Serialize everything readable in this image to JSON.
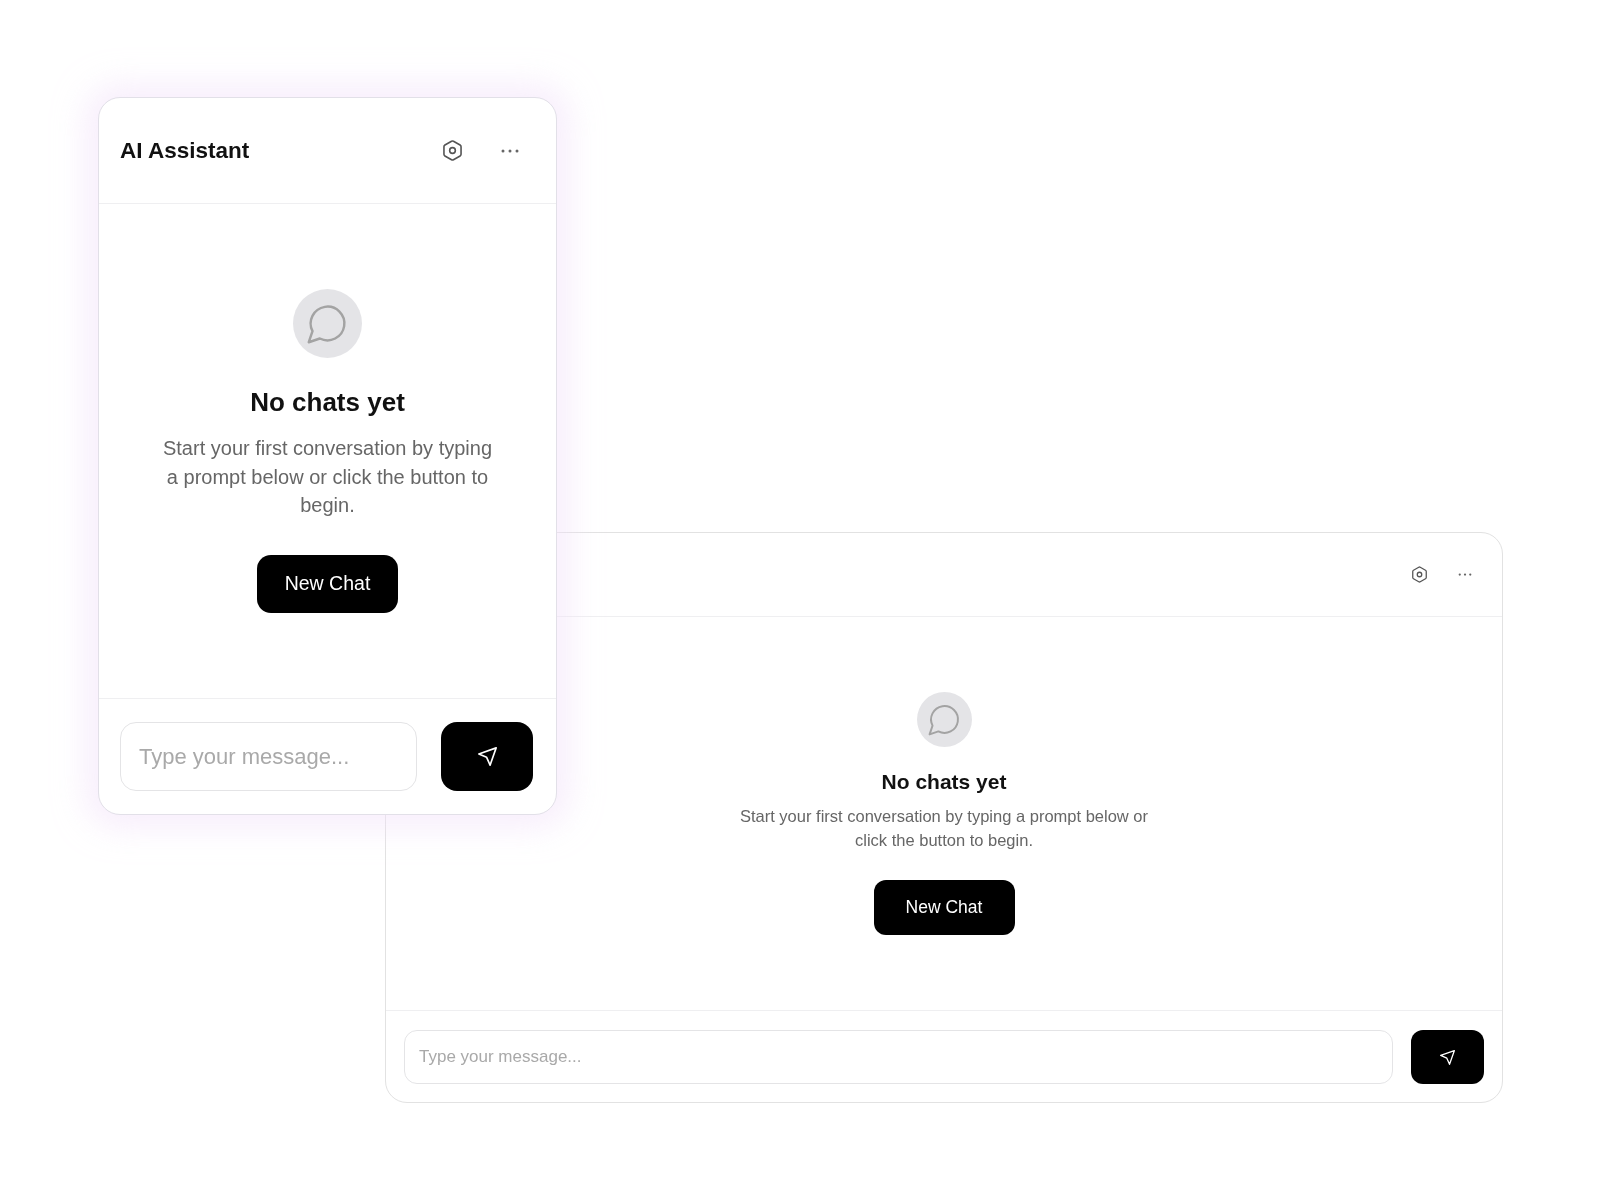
{
  "windows": [
    {
      "kind": "compact",
      "title": "AI Assistant",
      "empty_state": {
        "heading": "No chats yet",
        "message": "Start your first conversation by typing a prompt below or click the button to begin.",
        "button": "New Chat"
      },
      "composer": {
        "placeholder": "Type your message..."
      }
    },
    {
      "kind": "wide",
      "empty_state": {
        "heading": "No chats yet",
        "message": "Start your first conversation by typing a prompt below or click the button to begin.",
        "button": "New Chat"
      },
      "composer": {
        "placeholder": "Type your message..."
      }
    }
  ]
}
